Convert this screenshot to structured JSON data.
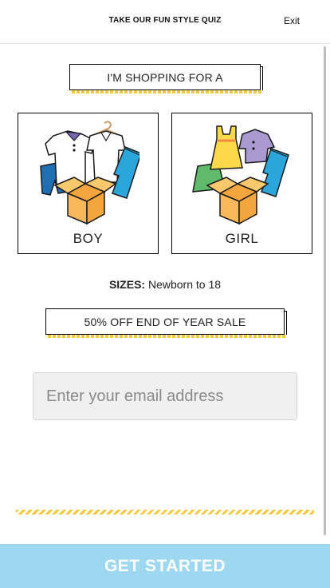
{
  "header": {
    "title": "TAKE OUR FUN STYLE QUIZ",
    "exit_label": "Exit"
  },
  "intro_tag": {
    "label": "I'M SHOPPING FOR A"
  },
  "options": [
    {
      "label": "BOY",
      "icon": "boy-clothes-box-icon"
    },
    {
      "label": "GIRL",
      "icon": "girl-clothes-box-icon"
    }
  ],
  "sizes": {
    "label": "SIZES:",
    "value": "Newborn to 18"
  },
  "promo_tag": {
    "label": "50% OFF END OF YEAR SALE"
  },
  "email": {
    "placeholder": "Enter your email address",
    "value": ""
  },
  "cta": {
    "label": "GET STARTED"
  },
  "colors": {
    "accent_yellow": "#f4c942",
    "cta_blue": "#9ed8f0",
    "box_orange": "#f9b85c",
    "jeans_blue": "#2aa6dd"
  }
}
